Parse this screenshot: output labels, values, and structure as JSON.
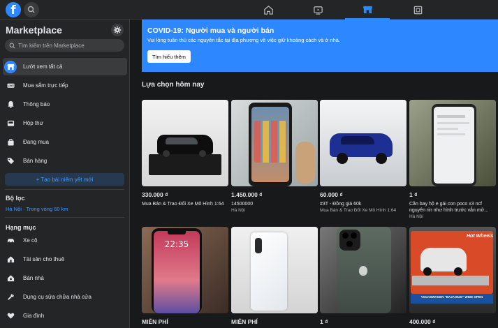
{
  "topbar": {
    "logo_letter": "f",
    "tabs": [
      {
        "name": "home",
        "active": false
      },
      {
        "name": "watch",
        "active": false
      },
      {
        "name": "marketplace",
        "active": true
      },
      {
        "name": "gaming",
        "active": false
      }
    ]
  },
  "sidebar": {
    "title": "Marketplace",
    "search_placeholder": "Tìm kiếm trên Marketplace",
    "items": [
      {
        "label": "Lướt xem tất cả",
        "icon": "storefront-icon",
        "active": true
      },
      {
        "label": "Mua sắm trực tiếp",
        "icon": "live-icon",
        "active": false
      },
      {
        "label": "Thông báo",
        "icon": "bell-icon",
        "active": false
      },
      {
        "label": "Hộp thư",
        "icon": "inbox-icon",
        "active": false
      },
      {
        "label": "Đang mua",
        "icon": "bag-icon",
        "active": false
      },
      {
        "label": "Bán hàng",
        "icon": "tag-icon",
        "active": false
      }
    ],
    "create_button": "+ Tạo bài niêm yết mới",
    "filters_heading": "Bộ lọc",
    "location": "Hà Nội · Trong vòng 60 km",
    "categories_heading": "Hạng mục",
    "categories": [
      {
        "label": "Xe cộ",
        "icon": "car-icon"
      },
      {
        "label": "Tài sản cho thuê",
        "icon": "house-icon"
      },
      {
        "label": "Bán nhà",
        "icon": "home-sale-icon"
      },
      {
        "label": "Dụng cụ sửa chữa nhà cửa",
        "icon": "wrench-icon"
      },
      {
        "label": "Gia đình",
        "icon": "heart-icon"
      }
    ]
  },
  "banner": {
    "title": "COVID-19: Người mua và người bán",
    "text": "Vui lòng tuân thủ các nguyên tắc tại địa phương về việc giữ khoảng cách và ở nhà.",
    "button": "Tìm hiểu thêm"
  },
  "section_title": "Lựa chọn hôm nay",
  "listings": [
    {
      "price": "330.000 ₫",
      "title": "Mua Bán & Trao Đổi Xe Mô Hình 1:64",
      "location": ""
    },
    {
      "price": "1.450.000 ₫",
      "title": "14500000",
      "location": "Hà Nội"
    },
    {
      "price": "60.000 ₫",
      "title": "#3T - Đồng giá 60k",
      "location": "Mua Bán & Trao Đổi Xe Mô Hình 1:64"
    },
    {
      "price": "1 ₫",
      "title": "Cần bay hộ e gái con poco x3 ncf nguyên rin như hình trước vẫn mở...",
      "location": "Hà Nội"
    },
    {
      "price": "MIỄN PHÍ",
      "title": "",
      "location": ""
    },
    {
      "price": "MIỄN PHÍ",
      "title": "",
      "location": ""
    },
    {
      "price": "1 ₫",
      "title": "",
      "location": ""
    },
    {
      "price": "400.000 ₫",
      "title": "",
      "location": ""
    }
  ],
  "lockscreen_time": "22:35",
  "toy_box_label": "VOLKSWAGEN \"BAJA BUG\" WIDE OPEN",
  "toy_brand": "Hot Wheels",
  "colors": {
    "accent": "#2d88ff",
    "background": "#18191a",
    "surface": "#242526"
  }
}
